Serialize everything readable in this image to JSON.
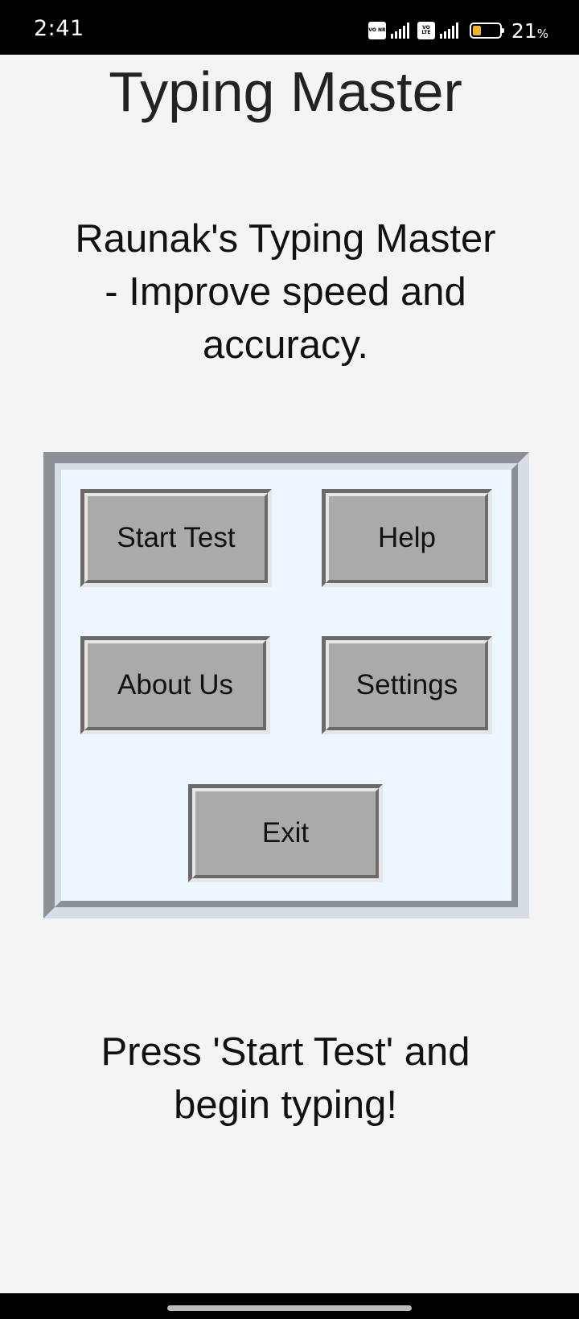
{
  "status_bar": {
    "time": "2:41",
    "sim1_badge": "VO NR",
    "sim2_badge": "VO LTE",
    "battery_percent": "21",
    "battery_unit": "%",
    "battery_level": 0.21,
    "battery_color": "#f0b429",
    "icons": [
      "volte-icon",
      "signal-icon",
      "volte-icon",
      "signal-icon",
      "battery-icon"
    ]
  },
  "header": {
    "title": "Typing Master",
    "subtitle": "Raunak's Typing Master - Improve speed and accuracy."
  },
  "menu": {
    "start_label": "Start Test",
    "help_label": "Help",
    "about_label": "About Us",
    "settings_label": "Settings",
    "exit_label": "Exit",
    "button_color": "#aaaaaa",
    "panel_color": "#eef6ff"
  },
  "footer": {
    "hint": "Press 'Start Test' and begin typing!"
  }
}
